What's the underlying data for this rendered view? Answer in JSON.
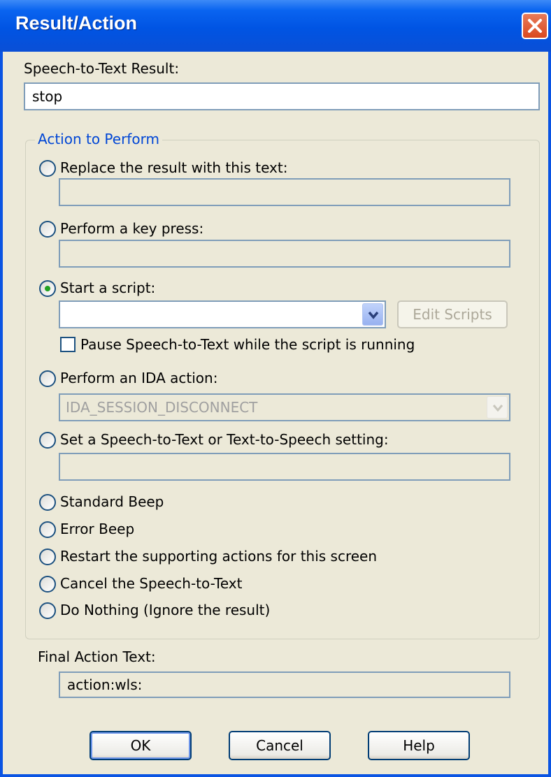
{
  "window": {
    "title": "Result/Action"
  },
  "result": {
    "label": "Speech-to-Text Result:",
    "value": "stop"
  },
  "action_group": {
    "legend": "Action to Perform",
    "replace": {
      "label": "Replace the result with this text:",
      "value": ""
    },
    "keypress": {
      "label": "Perform a key press:",
      "value": ""
    },
    "script": {
      "label": "Start a script:",
      "value": "",
      "edit_button": "Edit Scripts",
      "pause_label": "Pause Speech-to-Text while the script is running"
    },
    "ida": {
      "label": "Perform an IDA action:",
      "value": "IDA_SESSION_DISCONNECT"
    },
    "setting": {
      "label": "Set a Speech-to-Text or Text-to-Speech setting:",
      "value": ""
    },
    "standard_beep": "Standard Beep",
    "error_beep": "Error Beep",
    "restart": "Restart the supporting actions for this screen",
    "cancel_stt": "Cancel the Speech-to-Text",
    "do_nothing": "Do Nothing (Ignore the result)",
    "final": {
      "label": "Final Action Text:",
      "value": "action:wls:"
    }
  },
  "buttons": {
    "ok": "OK",
    "cancel": "Cancel",
    "help": "Help"
  },
  "selected_option": "start-script",
  "colors": {
    "titlebar": "#0054e3",
    "accent_legend": "#0046d5",
    "radio_selected": "#21a121",
    "close": "#d9481f"
  },
  "icons": {
    "close": "close-icon",
    "dropdown": "chevron-down-icon"
  }
}
